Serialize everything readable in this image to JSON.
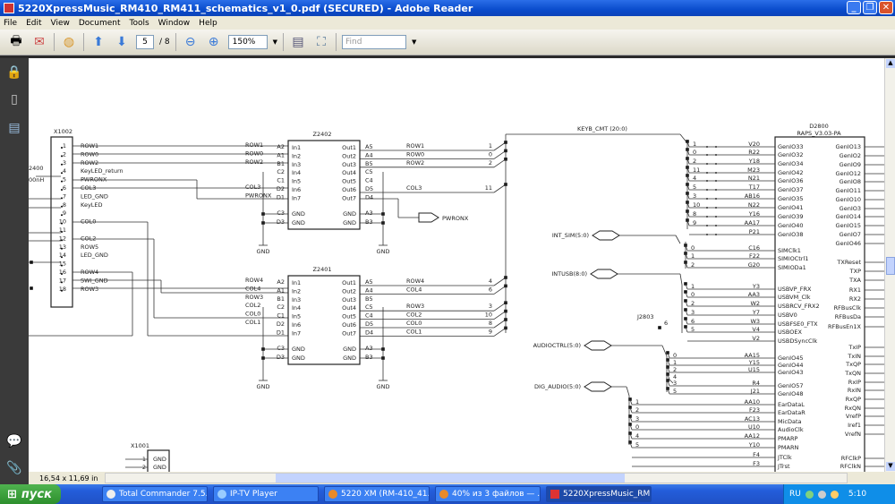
{
  "window": {
    "title": "5220XpressMusic_RM410_RM411_schematics_v1_0.pdf (SECURED) - Adobe Reader",
    "controls": [
      "_",
      "❐",
      "✕"
    ]
  },
  "menu": [
    "File",
    "Edit",
    "View",
    "Document",
    "Tools",
    "Window",
    "Help"
  ],
  "toolbar": {
    "page_current": "5",
    "page_total": "/ 8",
    "zoom": "150%",
    "find_placeholder": "Find"
  },
  "status": {
    "page_size": "16,54 x 11,69 in"
  },
  "taskbar": {
    "start": "пуск",
    "tasks": [
      "Total Commander 7.5...",
      "IP-TV Player",
      "5220 XM (RM-410_41...",
      "40% из 3 файлов — ...",
      "5220XpressMusic_RM..."
    ],
    "active_task": 4,
    "lang": "RU",
    "clock": "5:10"
  },
  "colors": {
    "titlebar": "#0a4ccc",
    "taskbar": "#245edb",
    "start": "#2d8f2d",
    "sidebar": "#3a3a3a"
  },
  "schematic": {
    "x1002": {
      "ref": "X1002",
      "pins": [
        "ROW1",
        "ROW0",
        "ROW2",
        "KeyLED_return",
        "PWRONX",
        "COL3",
        "LED_GND",
        "KeyLED",
        "",
        "COL0",
        "",
        "COL2",
        "ROW5",
        "LED_GND",
        "",
        "ROW4",
        "SWI_GND",
        "ROW3"
      ],
      "side_labels": [
        "2400",
        "00nH"
      ]
    },
    "x1001": {
      "ref": "X1001",
      "pins": [
        "GND",
        "GND"
      ]
    },
    "z2402": {
      "ref": "Z2402",
      "in_pins": [
        "In1",
        "In2",
        "In3",
        "In4",
        "In5",
        "In6",
        "In7"
      ],
      "in_balls": [
        "A2",
        "A1",
        "B1",
        "C2",
        "C1",
        "D2",
        "D1"
      ],
      "in_nets": [
        "ROW1",
        "ROW0",
        "ROW2",
        "",
        "",
        "COL3",
        "PWRONX"
      ],
      "out_pins": [
        "Out1",
        "Out2",
        "Out3",
        "Out4",
        "Out5",
        "Out6",
        "Out7"
      ],
      "out_balls": [
        "A5",
        "A4",
        "B5",
        "C5",
        "C4",
        "D5",
        "D4"
      ],
      "out_nets": [
        "ROW1",
        "ROW0",
        "ROW2",
        "",
        "",
        "COL3",
        ""
      ],
      "bus_idx": [
        "1",
        "0",
        "2",
        "",
        "",
        "11",
        ""
      ],
      "gnd_left_balls": [
        "C3",
        "D3"
      ],
      "gnd_right_balls": [
        "A3",
        "B3"
      ],
      "gnd": "GND",
      "port": "PWRONX"
    },
    "z2401": {
      "ref": "Z2401",
      "in_pins": [
        "In1",
        "In2",
        "In3",
        "In4",
        "In5",
        "In6",
        "In7"
      ],
      "in_balls": [
        "A2",
        "A1",
        "B1",
        "C2",
        "C1",
        "D2",
        "D1"
      ],
      "in_nets": [
        "ROW4",
        "COL4",
        "ROW3",
        "COL2",
        "COL0",
        "COL1",
        ""
      ],
      "out_pins": [
        "Out1",
        "Out2",
        "Out3",
        "Out4",
        "Out5",
        "Out6",
        "Out7"
      ],
      "out_balls": [
        "A5",
        "A4",
        "B5",
        "C5",
        "C4",
        "D5",
        "D4"
      ],
      "out_nets": [
        "ROW4",
        "COL4",
        "",
        "ROW3",
        "COL2",
        "COL0",
        "COL1"
      ],
      "bus_idx": [
        "4",
        "6",
        "",
        "3",
        "10",
        "8",
        "9"
      ],
      "gnd_left_balls": [
        "C3",
        "D3"
      ],
      "gnd_right_balls": [
        "A3",
        "B3"
      ],
      "gnd": "GND"
    },
    "buses": {
      "keyb": "KEYB_CMT (20:0)",
      "sim": "INT_SIM(5:0)",
      "usb": "INTUSB(8:0)",
      "audioctrl": "AUDIOCTRL(5:0)",
      "digaudio": "DIG_AUDIO(5:0)",
      "j2803": "J2803",
      "j2803_pin": "6"
    },
    "d2800": {
      "ref": "D2800",
      "type": "RAPS_V3.03-PA",
      "left": [
        [
          "1",
          "V20",
          "GenIO33"
        ],
        [
          "0",
          "R22",
          "GenIO32"
        ],
        [
          "2",
          "Y18",
          "GenIO34"
        ],
        [
          "11",
          "M23",
          "GenIO42"
        ],
        [
          "4",
          "N21",
          "GenIO36"
        ],
        [
          "5",
          "T17",
          "GenIO37"
        ],
        [
          "3",
          "AB16",
          "GenIO35"
        ],
        [
          "10",
          "N22",
          "GenIO41"
        ],
        [
          "8",
          "Y16",
          "GenIO39"
        ],
        [
          "9",
          "AA17",
          "GenIO40"
        ],
        [
          "",
          "P21",
          "GenIO38"
        ],
        [
          "0",
          "C16",
          "SIMClk1"
        ],
        [
          "1",
          "F22",
          "SIMIOCtrl1"
        ],
        [
          "2",
          "G20",
          "SIMIODa1"
        ],
        [
          "1",
          "Y3",
          "USBVP_FRX"
        ],
        [
          "0",
          "AA3",
          "USBVM_Clk"
        ],
        [
          "2",
          "W2",
          "USBRCV_FRX2"
        ],
        [
          "3",
          "Y7",
          "USBV0"
        ],
        [
          "6",
          "W3",
          "USBFSE0_FTX"
        ],
        [
          "5",
          "V4",
          "USBOEX"
        ],
        [
          "",
          "V2",
          "USBDSyncClk"
        ],
        [
          "0",
          "AA15",
          "GenIO45"
        ],
        [
          "1",
          "Y15",
          "GenIO44"
        ],
        [
          "2",
          "U15",
          "GenIO43"
        ],
        [
          "4",
          "",
          ""
        ],
        [
          "3",
          "R4",
          "GenIO57"
        ],
        [
          "5",
          "J21",
          "GenIO48"
        ],
        [
          "1",
          "AA10",
          "EarDataL"
        ],
        [
          "2",
          "F23",
          "EarDataR"
        ],
        [
          "3",
          "AC13",
          "MicData"
        ],
        [
          "0",
          "U10",
          "AudioClk"
        ],
        [
          "4",
          "AA12",
          "PMARP"
        ],
        [
          "5",
          "Y10",
          "PMARN"
        ],
        [
          "",
          "F4",
          "JTClk"
        ],
        [
          "",
          "F3",
          "JTrst"
        ]
      ],
      "right": [
        "GenIO13",
        "GenIO2",
        "GenIO9",
        "GenIO12",
        "GenIO8",
        "GenIO11",
        "GenIO10",
        "GenIO3",
        "GenIO14",
        "GenIO15",
        "GenIO7",
        "GenIO46",
        "TXReset",
        "TXP",
        "TXA",
        "RX1",
        "RX2",
        "RFBusClk",
        "RFBusDa",
        "RFBusEn1X",
        "TxIP",
        "TxIN",
        "TxQP",
        "TxQN",
        "RxIP",
        "RxIN",
        "RxQP",
        "RxQN",
        "VrefP",
        "Iref1",
        "VrefN",
        "RFClkP",
        "RFClkN"
      ]
    }
  }
}
